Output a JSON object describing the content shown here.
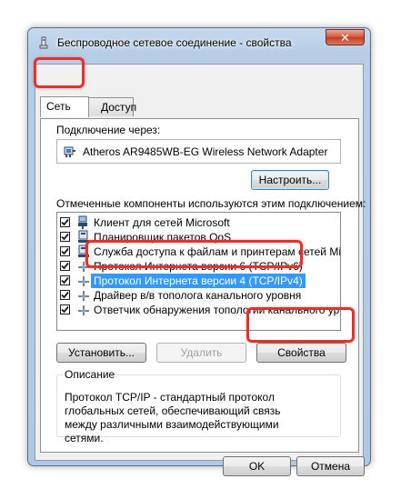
{
  "window": {
    "title": "Беспроводное сетевое соединение - свойства",
    "close_glyph": "✕"
  },
  "tabs": [
    {
      "label": "Сеть",
      "active": true
    },
    {
      "label": "Доступ",
      "active": false
    }
  ],
  "connection": {
    "connect_using_label": "Подключение через:",
    "adapter_name": "Atheros AR9485WB-EG Wireless Network Adapter",
    "configure_button": "Настроить..."
  },
  "components": {
    "label": "Отмеченные компоненты используются этим подключением:",
    "items": [
      {
        "label": "Клиент для сетей Microsoft",
        "checked": true,
        "icon": "network-client-icon"
      },
      {
        "label": "Планировщик пакетов QoS",
        "checked": true,
        "icon": "network-service-icon"
      },
      {
        "label": "Служба доступа к файлам и принтерам сетей Micro...",
        "checked": true,
        "icon": "network-service-icon"
      },
      {
        "label": "Протокол Интернета версии 6 (TCP/IPv6)",
        "checked": true,
        "icon": "protocol-icon"
      },
      {
        "label": "Протокол Интернета версии 4 (TCP/IPv4)",
        "checked": true,
        "icon": "protocol-icon",
        "selected": true
      },
      {
        "label": "Драйвер в/в тополога канального уровня",
        "checked": true,
        "icon": "protocol-icon"
      },
      {
        "label": "Ответчик обнаружения топологии канального уровня",
        "checked": true,
        "icon": "protocol-icon"
      }
    ]
  },
  "buttons": {
    "install": "Установить...",
    "uninstall": "Удалить",
    "properties": "Свойства",
    "ok": "OK",
    "cancel": "Отмена"
  },
  "description": {
    "title": "Описание",
    "text": "Протокол TCP/IP - стандартный протокол глобальных сетей, обеспечивающий связь между различными взаимодействующими сетями."
  },
  "colors": {
    "highlight": "#e5302c",
    "selection": "#3399ff"
  }
}
